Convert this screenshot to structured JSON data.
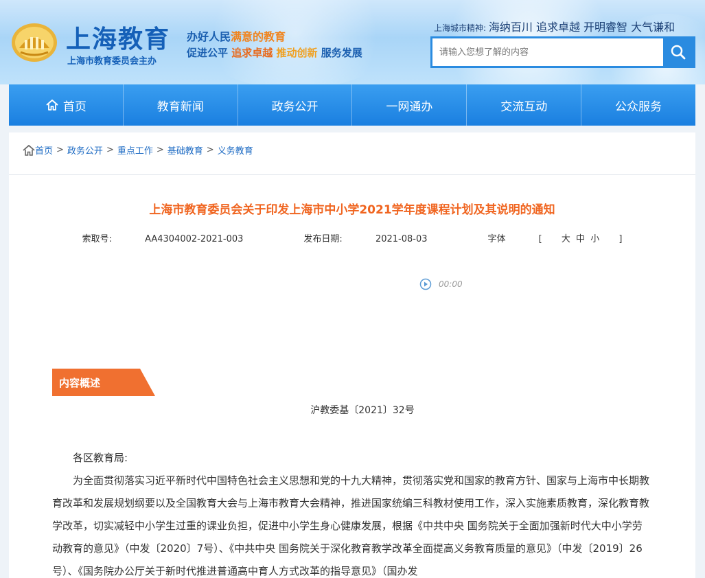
{
  "header": {
    "logo_title": "上海教育",
    "logo_sub": "上海市教育委员会主办",
    "slogan_line1_pre": "办好人民",
    "slogan_line1_hl": "满意的教育",
    "slogan_line2_a": "促进公平",
    "slogan_line2_b": "追求卓越",
    "slogan_line2_c": "推动创新",
    "slogan_line2_d": "服务发展",
    "spirit_label": "上海城市精神:",
    "spirit_text": "海纳百川 追求卓越 开明睿智 大气谦和",
    "search_placeholder": "请输入您想了解的内容"
  },
  "nav": [
    {
      "label": "首页"
    },
    {
      "label": "教育新闻"
    },
    {
      "label": "政务公开"
    },
    {
      "label": "一网通办"
    },
    {
      "label": "交流互动"
    },
    {
      "label": "公众服务"
    }
  ],
  "breadcrumb": [
    "首页",
    "政务公开",
    "重点工作",
    "基础教育",
    "义务教育"
  ],
  "article": {
    "title": "上海市教育委员会关于印发上海市中小学2021学年度课程计划及其说明的通知",
    "index_label": "索取号:",
    "index_value": "AA4304002-2021-003",
    "date_label": "发布日期:",
    "date_value": "2021-08-03",
    "font_label": "字体",
    "font_open": "[",
    "font_big": "大",
    "font_mid": "中",
    "font_small": "小",
    "font_close": "]",
    "audio_time": "00:00",
    "section_tag": "内容概述",
    "doc_number": "沪教委基〔2021〕32号",
    "salutation": "各区教育局:",
    "paragraph1": "为全面贯彻落实习近平新时代中国特色社会主义思想和党的十九大精神，贯彻落实党和国家的教育方针、国家与上海市中长期教育改革和发展规划纲要以及全国教育大会与上海市教育大会精神，推进国家统编三科教材使用工作，深入实施素质教育，深化教育教学改革，切实减轻中小学生过重的课业负担，促进中小学生身心健康发展，根据《中共中央 国务院关于全面加强新时代大中小学劳动教育的意见》（中发〔2020〕7号）、《中共中央 国务院关于深化教育教学改革全面提高义务教育质量的意见》（中发〔2019〕26号）、《国务院办公厅关于新时代推进普通高中育人方式改革的指导意见》（国办发"
  },
  "colors": {
    "brand_blue": "#1560b8",
    "nav_blue": "#1a7fe0",
    "title_orange": "#f06520",
    "tag_orange": "#f07030"
  }
}
